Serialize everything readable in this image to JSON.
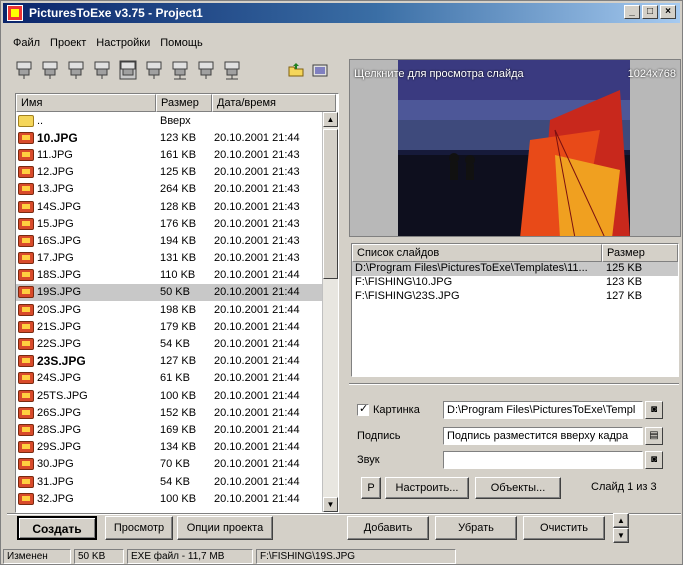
{
  "window": {
    "title": "PicturesToExe v3.75 - Project1",
    "minimize": "_",
    "maximize": "□",
    "close": "×"
  },
  "menu": [
    "Файл",
    "Проект",
    "Настройки",
    "Помощь"
  ],
  "file_list": {
    "headers": [
      "Имя",
      "Размер",
      "Дата/время"
    ],
    "rows": [
      {
        "name": "..",
        "size": "Вверх",
        "date": "",
        "icon": "folder-icon",
        "bold": false,
        "selected": false
      },
      {
        "name": "10.JPG",
        "size": "123 KB",
        "date": "20.10.2001  21:44",
        "icon": "image-file-icon",
        "bold": true,
        "selected": false
      },
      {
        "name": "11.JPG",
        "size": "161 KB",
        "date": "20.10.2001  21:43",
        "icon": "image-file-icon",
        "bold": false,
        "selected": false
      },
      {
        "name": "12.JPG",
        "size": "125 KB",
        "date": "20.10.2001  21:43",
        "icon": "image-file-icon",
        "bold": false,
        "selected": false
      },
      {
        "name": "13.JPG",
        "size": "264 KB",
        "date": "20.10.2001  21:43",
        "icon": "image-file-icon",
        "bold": false,
        "selected": false
      },
      {
        "name": "14S.JPG",
        "size": "128 KB",
        "date": "20.10.2001  21:43",
        "icon": "image-file-icon",
        "bold": false,
        "selected": false
      },
      {
        "name": "15.JPG",
        "size": "176 KB",
        "date": "20.10.2001  21:43",
        "icon": "image-file-icon",
        "bold": false,
        "selected": false
      },
      {
        "name": "16S.JPG",
        "size": "194 KB",
        "date": "20.10.2001  21:43",
        "icon": "image-file-icon",
        "bold": false,
        "selected": false
      },
      {
        "name": "17.JPG",
        "size": "131 KB",
        "date": "20.10.2001  21:43",
        "icon": "image-file-icon",
        "bold": false,
        "selected": false
      },
      {
        "name": "18S.JPG",
        "size": "110 KB",
        "date": "20.10.2001  21:44",
        "icon": "image-file-icon",
        "bold": false,
        "selected": false
      },
      {
        "name": "19S.JPG",
        "size": "50 KB",
        "date": "20.10.2001  21:44",
        "icon": "image-file-icon",
        "bold": false,
        "selected": true
      },
      {
        "name": "20S.JPG",
        "size": "198 KB",
        "date": "20.10.2001  21:44",
        "icon": "image-file-icon",
        "bold": false,
        "selected": false
      },
      {
        "name": "21S.JPG",
        "size": "179 KB",
        "date": "20.10.2001  21:44",
        "icon": "image-file-icon",
        "bold": false,
        "selected": false
      },
      {
        "name": "22S.JPG",
        "size": "54 KB",
        "date": "20.10.2001  21:44",
        "icon": "image-file-icon",
        "bold": false,
        "selected": false
      },
      {
        "name": "23S.JPG",
        "size": "127 KB",
        "date": "20.10.2001  21:44",
        "icon": "image-file-icon",
        "bold": true,
        "selected": false
      },
      {
        "name": "24S.JPG",
        "size": "61 KB",
        "date": "20.10.2001  21:44",
        "icon": "image-file-icon",
        "bold": false,
        "selected": false
      },
      {
        "name": "25TS.JPG",
        "size": "100 KB",
        "date": "20.10.2001  21:44",
        "icon": "image-file-icon",
        "bold": false,
        "selected": false
      },
      {
        "name": "26S.JPG",
        "size": "152 KB",
        "date": "20.10.2001  21:44",
        "icon": "image-file-icon",
        "bold": false,
        "selected": false
      },
      {
        "name": "28S.JPG",
        "size": "169 KB",
        "date": "20.10.2001  21:44",
        "icon": "image-file-icon",
        "bold": false,
        "selected": false
      },
      {
        "name": "29S.JPG",
        "size": "134 KB",
        "date": "20.10.2001  21:44",
        "icon": "image-file-icon",
        "bold": false,
        "selected": false
      },
      {
        "name": "30.JPG",
        "size": "70 KB",
        "date": "20.10.2001  21:44",
        "icon": "image-file-icon",
        "bold": false,
        "selected": false
      },
      {
        "name": "31.JPG",
        "size": "54 KB",
        "date": "20.10.2001  21:44",
        "icon": "image-file-icon",
        "bold": false,
        "selected": false
      },
      {
        "name": "32.JPG",
        "size": "100 KB",
        "date": "20.10.2001  21:44",
        "icon": "image-file-icon",
        "bold": false,
        "selected": false
      }
    ]
  },
  "preview": {
    "hint": "Щелкните для просмотра слайда",
    "resolution": "1024x768"
  },
  "slide_list": {
    "headers": [
      "Список слайдов",
      "Размер"
    ],
    "rows": [
      {
        "path": "D:\\Program Files\\PicturesToExe\\Templates\\11...",
        "size": "125 KB",
        "selected": true
      },
      {
        "path": "F:\\FISHING\\10.JPG",
        "size": "123 KB",
        "selected": false
      },
      {
        "path": "F:\\FISHING\\23S.JPG",
        "size": "127 KB",
        "selected": false
      }
    ]
  },
  "properties": {
    "picture_label": "Картинка",
    "picture_value": "D:\\Program Files\\PicturesToExe\\Templ",
    "caption_label": "Подпись",
    "caption_value": "Подпись разместится вверху кадра",
    "sound_label": "Звук",
    "sound_value": "",
    "p_button": "P",
    "setup_button": "Настроить...",
    "objects_button": "Объекты...",
    "slide_counter": "Слайд 1 из 3"
  },
  "buttons": {
    "create": "Создать",
    "preview": "Просмотр",
    "project_options": "Опции проекта",
    "add": "Добавить",
    "remove": "Убрать",
    "clear": "Очистить"
  },
  "status": [
    "Изменен",
    "50 KB",
    "EXE файл - 11,7 MB",
    "F:\\FISHING\\19S.JPG"
  ]
}
